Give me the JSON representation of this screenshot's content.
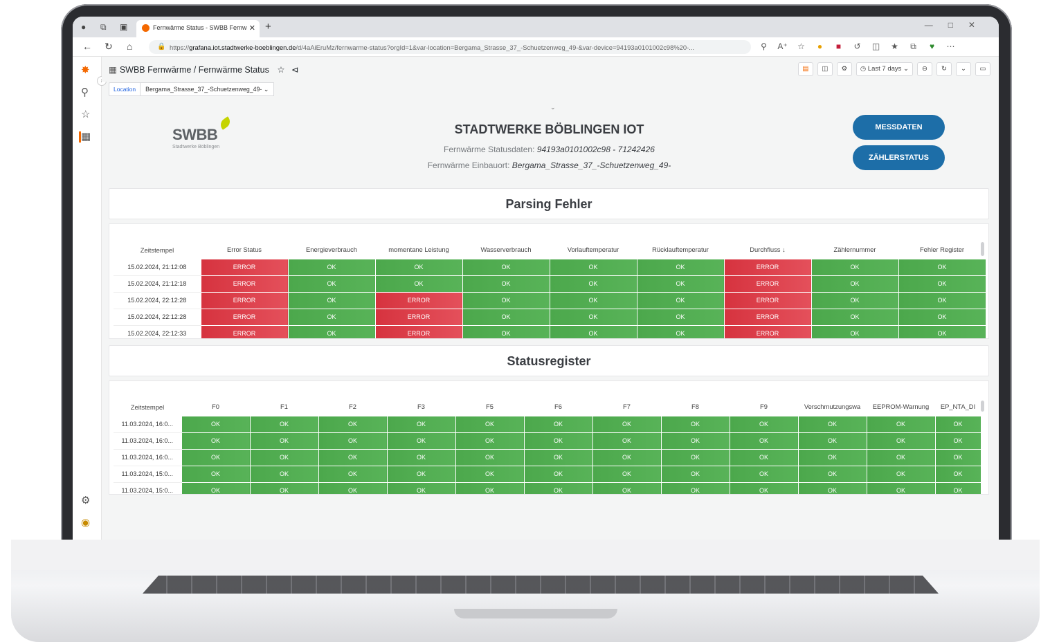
{
  "browser": {
    "tab_title": "Fernwärme Status - SWBB Fernw",
    "url_prefix": "https://",
    "url_host": "grafana.iot.stadtwerke-boeblingen.de",
    "url_path": "/d/4aAiEruMz/fernwarme-status?orgId=1&var-location=Bergama_Strasse_37_-Schuetzenweg_49-&var-device=94193a0101002c98%20-..."
  },
  "dashboard": {
    "breadcrumb_folder": "SWBB Fernwärme",
    "breadcrumb_sep": " / ",
    "breadcrumb_title": "Fernwärme Status",
    "time_range": "Last 7 days",
    "location_label": "Location",
    "location_value": "Bergama_Strasse_37_-Schuetzenweg_49-"
  },
  "header": {
    "logo_text": "SWBB",
    "logo_sub": "Stadtwerke Böblingen",
    "title": "STADTWERKE BÖBLINGEN IOT",
    "status_label": "Fernwärme Statusdaten: ",
    "status_value": "94193a0101002c98 - 71242426",
    "location_label": "Fernwärme Einbauort: ",
    "location_value": "Bergama_Strasse_37_-Schuetzenweg_49-",
    "btn_messdaten": "MESSDATEN",
    "btn_zaehlerstatus": "ZÄHLERSTATUS"
  },
  "parsing": {
    "title": "Parsing Fehler",
    "columns": [
      "Zeitstempel",
      "Error Status",
      "Energieverbrauch",
      "momentane Leistung",
      "Wasserverbrauch",
      "Vorlauftemperatur",
      "Rücklauftemperatur",
      "Durchfluss ↓",
      "Zählernummer",
      "Fehler Register"
    ],
    "rows": [
      [
        "15.02.2024, 21:12:08",
        "ERROR",
        "OK",
        "OK",
        "OK",
        "OK",
        "OK",
        "ERROR",
        "OK",
        "OK"
      ],
      [
        "15.02.2024, 21:12:18",
        "ERROR",
        "OK",
        "OK",
        "OK",
        "OK",
        "OK",
        "ERROR",
        "OK",
        "OK"
      ],
      [
        "15.02.2024, 22:12:28",
        "ERROR",
        "OK",
        "ERROR",
        "OK",
        "OK",
        "OK",
        "ERROR",
        "OK",
        "OK"
      ],
      [
        "15.02.2024, 22:12:28",
        "ERROR",
        "OK",
        "ERROR",
        "OK",
        "OK",
        "OK",
        "ERROR",
        "OK",
        "OK"
      ],
      [
        "15.02.2024, 22:12:33",
        "ERROR",
        "OK",
        "ERROR",
        "OK",
        "OK",
        "OK",
        "ERROR",
        "OK",
        "OK"
      ]
    ]
  },
  "status": {
    "title": "Statusregister",
    "columns": [
      "Zeitstempel",
      "F0",
      "F1",
      "F2",
      "F3",
      "F5",
      "F6",
      "F7",
      "F8",
      "F9",
      "Verschmutzungswa",
      "EEPROM-Warnung",
      "EP_NTA_DI"
    ],
    "rows": [
      [
        "11.03.2024, 16:0...",
        "OK",
        "OK",
        "OK",
        "OK",
        "OK",
        "OK",
        "OK",
        "OK",
        "OK",
        "OK",
        "OK",
        "OK"
      ],
      [
        "11.03.2024, 16:0...",
        "OK",
        "OK",
        "OK",
        "OK",
        "OK",
        "OK",
        "OK",
        "OK",
        "OK",
        "OK",
        "OK",
        "OK"
      ],
      [
        "11.03.2024, 16:0...",
        "OK",
        "OK",
        "OK",
        "OK",
        "OK",
        "OK",
        "OK",
        "OK",
        "OK",
        "OK",
        "OK",
        "OK"
      ],
      [
        "11.03.2024, 15:0...",
        "OK",
        "OK",
        "OK",
        "OK",
        "OK",
        "OK",
        "OK",
        "OK",
        "OK",
        "OK",
        "OK",
        "OK"
      ],
      [
        "11.03.2024, 15:0...",
        "OK",
        "OK",
        "OK",
        "OK",
        "OK",
        "OK",
        "OK",
        "OK",
        "OK",
        "OK",
        "OK",
        "OK"
      ]
    ]
  },
  "colors": {
    "ok": "#4ca84c",
    "error": "#d6333f",
    "button": "#1d6ea8",
    "grafana_orange": "#f46800"
  },
  "icons": {
    "sidebar": [
      "grafana-logo-icon",
      "search-icon",
      "star-icon",
      "dashboards-icon",
      "settings-icon",
      "user-avatar-icon"
    ]
  }
}
